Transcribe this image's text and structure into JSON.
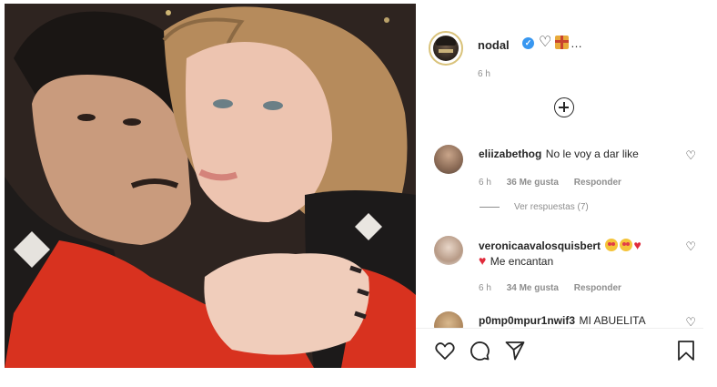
{
  "post": {
    "username": "nodal",
    "caption_suffix": "…",
    "time": "6 h",
    "heart_icon": "♡"
  },
  "comments": [
    {
      "username": "eliizabethog",
      "text": "No le voy a dar like",
      "time": "6 h",
      "likes": "36 Me gusta",
      "reply": "Responder",
      "replies_label": "Ver respuestas (7)"
    },
    {
      "username": "veronicaavalosquisbert",
      "text": "Me encantan",
      "time": "6 h",
      "likes": "34 Me gusta",
      "reply": "Responder"
    },
    {
      "username": "p0mp0mpur1nwif3",
      "text": "MI ABUELITA"
    }
  ],
  "colors": {
    "verified": "#3897f0",
    "meta_gray": "#8e8e8e",
    "heart_red": "#e02a3b"
  },
  "icons": {
    "like": "heart-outline-icon",
    "comment": "speech-bubble-icon",
    "share": "paper-plane-icon",
    "save": "bookmark-icon",
    "add": "plus-circle-icon",
    "verified": "verified-badge-icon"
  }
}
